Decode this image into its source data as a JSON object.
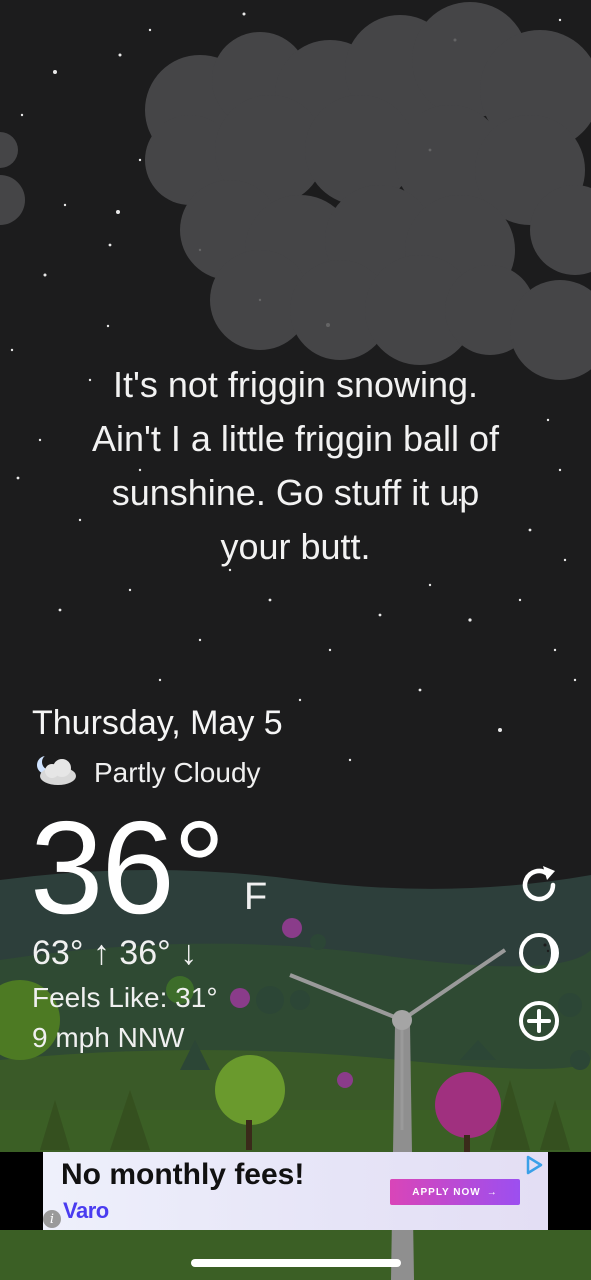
{
  "message": [
    "It's not friggin snowing.",
    "Ain't I a little friggin ball of",
    "sunshine. Go stuff it up",
    "your butt."
  ],
  "date": "Thursday, May 5",
  "condition": {
    "icon": "partly-cloudy-night-icon",
    "text": "Partly Cloudy"
  },
  "temperature": {
    "value": "36°",
    "unit": "F"
  },
  "high_low": "63° ↑ 36° ↓",
  "feels_like": "Feels Like: 31°",
  "wind": "9 mph NNW",
  "side_buttons": [
    {
      "icon": "refresh-icon"
    },
    {
      "icon": "moon-phase-icon"
    },
    {
      "icon": "add-location-icon"
    }
  ],
  "ad": {
    "headline": "No monthly fees!",
    "brand": "Varo",
    "cta": "APPLY NOW",
    "cta_arrow": "→",
    "info": "i",
    "accent": "#4a3cf0"
  },
  "colors": {
    "sky": "#1c1c1d",
    "cloud": "#555555",
    "grass": "#3a5a28",
    "hills": "#2d3f3b"
  }
}
